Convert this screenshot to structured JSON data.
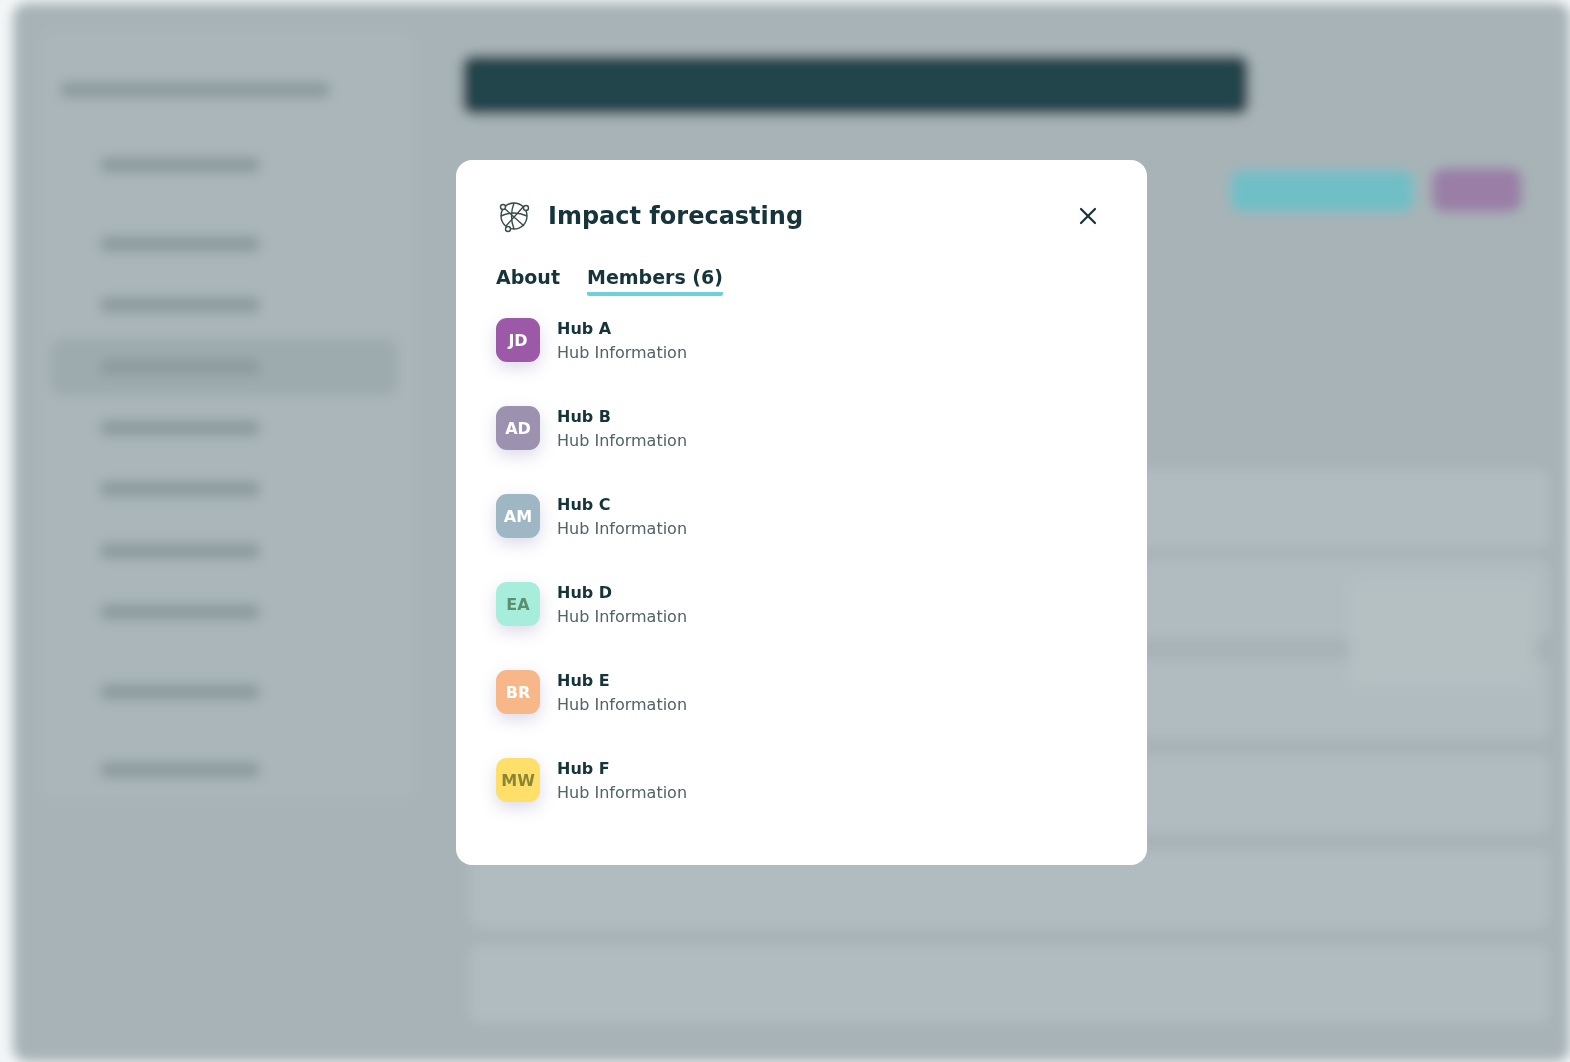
{
  "dialog": {
    "title": "Impact forecasting",
    "tabs": [
      {
        "label": "About",
        "selected": false
      },
      {
        "label": "Members (6)",
        "selected": true
      }
    ],
    "members": [
      {
        "initials": "JD",
        "name": "Hub A",
        "info": "Hub Information",
        "color": "#9b59a8"
      },
      {
        "initials": "AD",
        "name": "Hub B",
        "info": "Hub Information",
        "color": "#9c92b0"
      },
      {
        "initials": "AM",
        "name": "Hub C",
        "info": "Hub Information",
        "color": "#9fb6c4"
      },
      {
        "initials": "EA",
        "name": "Hub D",
        "info": "Hub Information",
        "color": "#a6eedb"
      },
      {
        "initials": "BR",
        "name": "Hub E",
        "info": "Hub Information",
        "color": "#f8b788"
      },
      {
        "initials": "MW",
        "name": "Hub F",
        "info": "Hub Information",
        "color": "#fddf6a"
      }
    ]
  }
}
